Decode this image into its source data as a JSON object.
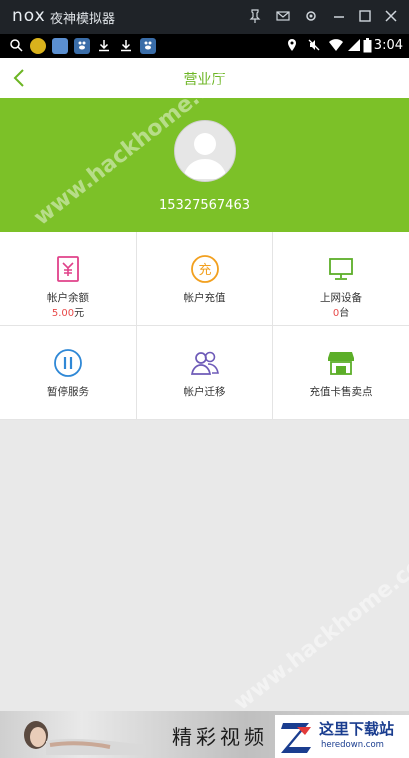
{
  "emulator": {
    "logo": "nox",
    "title": "夜神模拟器",
    "controls": [
      "pin-icon",
      "mail-icon",
      "gear-icon",
      "minimize-icon",
      "maximize-icon",
      "close-icon"
    ]
  },
  "status_bar": {
    "time": "3:04",
    "notification_icons": [
      "search-icon",
      "app-icon",
      "app-icon",
      "baidu-icon",
      "download-icon",
      "download-icon",
      "baidu-icon"
    ],
    "system_icons": [
      "location-icon",
      "mute-icon",
      "wifi-icon",
      "signal-icon",
      "battery-icon"
    ]
  },
  "header": {
    "title": "营业厅"
  },
  "profile": {
    "phone": "15327567463"
  },
  "grid": {
    "items": [
      {
        "label": "帐户余额",
        "value_num": "5.00",
        "value_unit": "元",
        "icon": "wallet-yen-icon"
      },
      {
        "label": "帐户充值",
        "icon": "recharge-icon"
      },
      {
        "label": "上网设备",
        "value_num": "0",
        "value_unit": "台",
        "icon": "monitor-icon"
      },
      {
        "label": "暂停服务",
        "icon": "pause-icon"
      },
      {
        "label": "帐户迁移",
        "icon": "users-icon"
      },
      {
        "label": "充值卡售卖点",
        "icon": "store-icon"
      }
    ]
  },
  "ad": {
    "text": "精彩视频",
    "logo_name": "这里下载站",
    "logo_url": "heredown.com"
  },
  "colors": {
    "accent_green": "#7cc128",
    "title_green": "#6cb523",
    "value_red": "#e84a4a",
    "icon_pink": "#e0428a",
    "icon_orange": "#f2a01f",
    "icon_green": "#5cae28",
    "icon_blue": "#2f88d6",
    "icon_purple": "#6e5bb8"
  },
  "watermarks": [
    "www.hackhome.com",
    "www.hackhome.com"
  ]
}
